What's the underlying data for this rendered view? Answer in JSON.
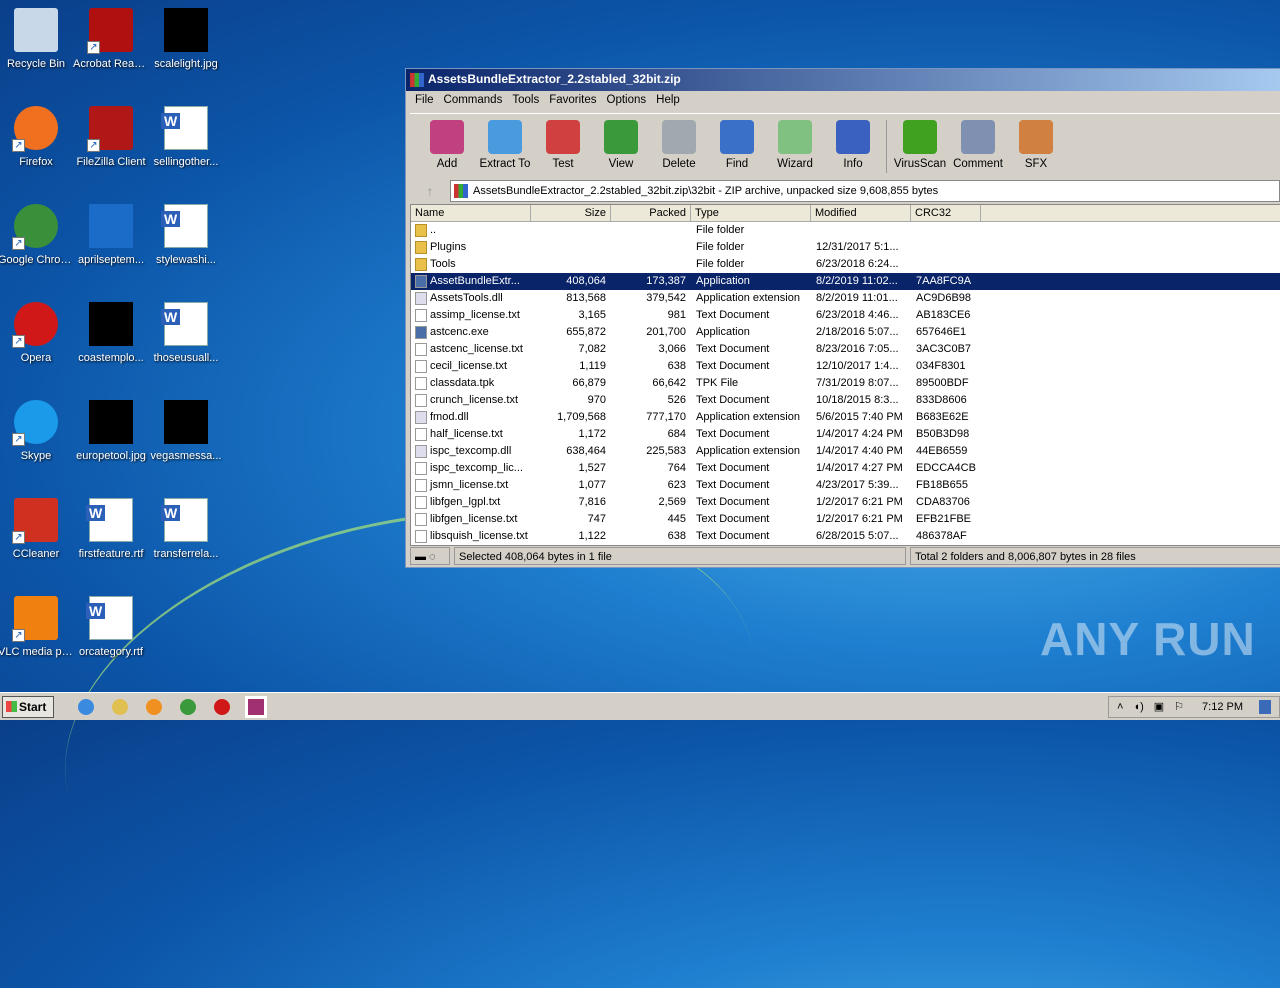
{
  "desktop": {
    "icons": [
      {
        "label": "Recycle Bin",
        "icon": "recycle-bin-icon",
        "color": "#c8d8e8",
        "shortcut": false
      },
      {
        "label": "Acrobat Reader DC",
        "icon": "acrobat-icon",
        "color": "#b01010",
        "shortcut": true
      },
      {
        "label": "scalelight.jpg",
        "icon": "image-icon",
        "color": "#000",
        "shortcut": false
      },
      {
        "label": "Firefox",
        "icon": "firefox-icon",
        "color": "#f07020",
        "shortcut": true
      },
      {
        "label": "FileZilla Client",
        "icon": "filezilla-icon",
        "color": "#b01818",
        "shortcut": true
      },
      {
        "label": "sellingother...",
        "icon": "word-doc-icon",
        "color": "#fff",
        "shortcut": false
      },
      {
        "label": "Google Chrome",
        "icon": "chrome-icon",
        "color": "#3a8f3a",
        "shortcut": true
      },
      {
        "label": "aprilseptem...",
        "icon": "image-icon",
        "color": "#1a6cc8",
        "shortcut": false
      },
      {
        "label": "stylewashi...",
        "icon": "word-doc-icon",
        "color": "#fff",
        "shortcut": false
      },
      {
        "label": "Opera",
        "icon": "opera-icon",
        "color": "#d01818",
        "shortcut": true
      },
      {
        "label": "coastemplo...",
        "icon": "image-icon",
        "color": "#000",
        "shortcut": false
      },
      {
        "label": "thoseusuall...",
        "icon": "word-doc-icon",
        "color": "#fff",
        "shortcut": false
      },
      {
        "label": "Skype",
        "icon": "skype-icon",
        "color": "#1a9ae8",
        "shortcut": true
      },
      {
        "label": "europetool.jpg",
        "icon": "image-icon",
        "color": "#000",
        "shortcut": false
      },
      {
        "label": "vegasmessa...",
        "icon": "image-icon",
        "color": "#000",
        "shortcut": false
      },
      {
        "label": "CCleaner",
        "icon": "ccleaner-icon",
        "color": "#d03020",
        "shortcut": true
      },
      {
        "label": "firstfeature.rtf",
        "icon": "word-doc-icon",
        "color": "#fff",
        "shortcut": false
      },
      {
        "label": "transferrela...",
        "icon": "word-doc-icon",
        "color": "#fff",
        "shortcut": false
      },
      {
        "label": "VLC media player",
        "icon": "vlc-icon",
        "color": "#f08010",
        "shortcut": true
      },
      {
        "label": "orcategory.rtf",
        "icon": "word-doc-icon",
        "color": "#fff",
        "shortcut": false
      }
    ]
  },
  "window": {
    "title": "AssetsBundleExtractor_2.2stabled_32bit.zip",
    "menu": [
      "File",
      "Commands",
      "Tools",
      "Favorites",
      "Options",
      "Help"
    ],
    "toolbar": [
      {
        "label": "Add",
        "icon": "add-archive-icon",
        "color": "#c04080"
      },
      {
        "label": "Extract To",
        "icon": "extract-folder-icon",
        "color": "#4a9ae0"
      },
      {
        "label": "Test",
        "icon": "test-clipboard-icon",
        "color": "#d04040"
      },
      {
        "label": "View",
        "icon": "view-book-icon",
        "color": "#3a9a3a"
      },
      {
        "label": "Delete",
        "icon": "delete-trash-icon",
        "color": "#a0a8b0"
      },
      {
        "label": "Find",
        "icon": "find-magnifier-icon",
        "color": "#3a70c8"
      },
      {
        "label": "Wizard",
        "icon": "wizard-wand-icon",
        "color": "#80c080"
      },
      {
        "label": "Info",
        "icon": "info-icon",
        "color": "#3a60c0"
      },
      {
        "label": "VirusScan",
        "icon": "virusscan-icon",
        "color": "#40a020"
      },
      {
        "label": "Comment",
        "icon": "comment-icon",
        "color": "#8090b0"
      },
      {
        "label": "SFX",
        "icon": "sfx-icon",
        "color": "#d08040"
      }
    ],
    "address": "AssetsBundleExtractor_2.2stabled_32bit.zip\\32bit - ZIP archive, unpacked size 9,608,855 bytes",
    "columns": [
      "Name",
      "Size",
      "Packed",
      "Type",
      "Modified",
      "CRC32"
    ],
    "files": [
      {
        "name": "..",
        "size": "",
        "packed": "",
        "type": "File folder",
        "modified": "",
        "crc": "",
        "kind": "folder"
      },
      {
        "name": "Plugins",
        "size": "",
        "packed": "",
        "type": "File folder",
        "modified": "12/31/2017 5:1...",
        "crc": "",
        "kind": "folder"
      },
      {
        "name": "Tools",
        "size": "",
        "packed": "",
        "type": "File folder",
        "modified": "6/23/2018 6:24...",
        "crc": "",
        "kind": "folder"
      },
      {
        "name": "AssetBundleExtr...",
        "size": "408,064",
        "packed": "173,387",
        "type": "Application",
        "modified": "8/2/2019 11:02...",
        "crc": "7AA8FC9A",
        "kind": "app",
        "selected": true
      },
      {
        "name": "AssetsTools.dll",
        "size": "813,568",
        "packed": "379,542",
        "type": "Application extension",
        "modified": "8/2/2019 11:01...",
        "crc": "AC9D6B98",
        "kind": "dll"
      },
      {
        "name": "assimp_license.txt",
        "size": "3,165",
        "packed": "981",
        "type": "Text Document",
        "modified": "6/23/2018 4:46...",
        "crc": "AB183CE6",
        "kind": "txt"
      },
      {
        "name": "astcenc.exe",
        "size": "655,872",
        "packed": "201,700",
        "type": "Application",
        "modified": "2/18/2016 5:07...",
        "crc": "657646E1",
        "kind": "app"
      },
      {
        "name": "astcenc_license.txt",
        "size": "7,082",
        "packed": "3,066",
        "type": "Text Document",
        "modified": "8/23/2016 7:05...",
        "crc": "3AC3C0B7",
        "kind": "txt"
      },
      {
        "name": "cecil_license.txt",
        "size": "1,119",
        "packed": "638",
        "type": "Text Document",
        "modified": "12/10/2017 1:4...",
        "crc": "034F8301",
        "kind": "txt"
      },
      {
        "name": "classdata.tpk",
        "size": "66,879",
        "packed": "66,642",
        "type": "TPK File",
        "modified": "7/31/2019 8:07...",
        "crc": "89500BDF",
        "kind": "txt"
      },
      {
        "name": "crunch_license.txt",
        "size": "970",
        "packed": "526",
        "type": "Text Document",
        "modified": "10/18/2015 8:3...",
        "crc": "833D8606",
        "kind": "txt"
      },
      {
        "name": "fmod.dll",
        "size": "1,709,568",
        "packed": "777,170",
        "type": "Application extension",
        "modified": "5/6/2015 7:40 PM",
        "crc": "B683E62E",
        "kind": "dll"
      },
      {
        "name": "half_license.txt",
        "size": "1,172",
        "packed": "684",
        "type": "Text Document",
        "modified": "1/4/2017 4:24 PM",
        "crc": "B50B3D98",
        "kind": "txt"
      },
      {
        "name": "ispc_texcomp.dll",
        "size": "638,464",
        "packed": "225,583",
        "type": "Application extension",
        "modified": "1/4/2017 4:40 PM",
        "crc": "44EB6559",
        "kind": "dll"
      },
      {
        "name": "ispc_texcomp_lic...",
        "size": "1,527",
        "packed": "764",
        "type": "Text Document",
        "modified": "1/4/2017 4:27 PM",
        "crc": "EDCCA4CB",
        "kind": "txt"
      },
      {
        "name": "jsmn_license.txt",
        "size": "1,077",
        "packed": "623",
        "type": "Text Document",
        "modified": "4/23/2017 5:39...",
        "crc": "FB18B655",
        "kind": "txt"
      },
      {
        "name": "libfgen_lgpl.txt",
        "size": "7,816",
        "packed": "2,569",
        "type": "Text Document",
        "modified": "1/2/2017 6:21 PM",
        "crc": "CDA83706",
        "kind": "txt"
      },
      {
        "name": "libfgen_license.txt",
        "size": "747",
        "packed": "445",
        "type": "Text Document",
        "modified": "1/2/2017 6:21 PM",
        "crc": "EFB21FBE",
        "kind": "txt"
      },
      {
        "name": "libsquish_license.txt",
        "size": "1,122",
        "packed": "638",
        "type": "Text Document",
        "modified": "6/28/2015 5:07...",
        "crc": "486378AF",
        "kind": "txt"
      }
    ],
    "status_left": "Selected 408,064 bytes in 1 file",
    "status_right": "Total 2 folders and 8,006,807 bytes in 28 files"
  },
  "taskbar": {
    "start": "Start",
    "clock": "7:12 PM",
    "apps": [
      {
        "icon": "ie-icon",
        "color": "#3a8ae0"
      },
      {
        "icon": "explorer-icon",
        "color": "#e0c050"
      },
      {
        "icon": "media-player-icon",
        "color": "#f09020"
      },
      {
        "icon": "chrome-icon",
        "color": "#3a9a3a"
      },
      {
        "icon": "opera-icon",
        "color": "#d01818"
      },
      {
        "icon": "winrar-icon",
        "color": "#a03070"
      }
    ]
  },
  "watermark": "ANY RUN"
}
